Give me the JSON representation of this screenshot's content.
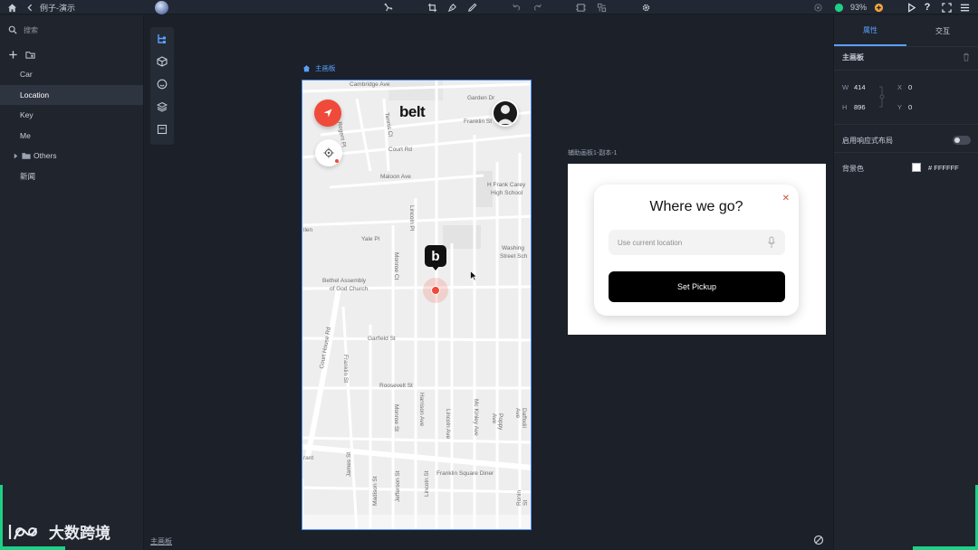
{
  "topbar": {
    "back_label": "例子-演示",
    "zoom": "93%"
  },
  "left_panel": {
    "search_placeholder": "搜索",
    "pages": [
      {
        "label": "Car"
      },
      {
        "label": "Location"
      },
      {
        "label": "Key"
      },
      {
        "label": "Me"
      },
      {
        "label": "Others"
      },
      {
        "label": "新闻"
      }
    ],
    "brand": "大数跨境"
  },
  "canvas": {
    "main_board_label": "主画板",
    "aux_board_label": "辅助画板1-副本-1",
    "bottom_board_label": "主画板"
  },
  "map": {
    "logo": "belt",
    "marker_letter": "b",
    "streets": {
      "cambridge": "Cambridge Ave",
      "garden": "Garden Dr",
      "franklin_top": "Franklin St",
      "regent": "Regent Pl",
      "tennis": "Tennis Ct",
      "court_rd": "Court Rd",
      "maloon": "Maloon Ave",
      "school": "H Frank Carey",
      "school2": "High School",
      "lincoln_pl": "Lincoln Pl",
      "yale": "Yale Pl",
      "allen": "llen",
      "washington": "Washing",
      "washington2": "Street Sch",
      "monroe_top": "Monroe Ct",
      "bethel": "Bethel Assembly",
      "bethel2": "of God Church",
      "court_house": "Court House Rd",
      "garfield": "Garfield St",
      "franklin_mid": "Franklin St",
      "roosevelt": "Roosevelt St",
      "monroe": "Monroe St",
      "harrison": "Harrison Ave",
      "lincoln_ave": "Lincoln Ave",
      "mckinley": "Mc Kinley Ave",
      "poppy": "Poppy Ave",
      "daffodil": "Daffodil Ave",
      "grant": "rant",
      "james": "James St",
      "madison": "Madison St",
      "jefferson": "Jefferson St",
      "lincoln_st": "Lincoln St",
      "franklin_sq": "Franklin Square Diner",
      "ronin": "Ronin St"
    }
  },
  "card": {
    "title": "Where we go?",
    "location_placeholder": "Use current location",
    "button_label": "Set Pickup"
  },
  "right_panel": {
    "tab_properties": "属性",
    "tab_interaction": "交互",
    "section_title": "主画板",
    "w_label": "W",
    "w_value": "414",
    "h_label": "H",
    "h_value": "896",
    "x_label": "X",
    "x_value": "0",
    "y_label": "Y",
    "y_value": "0",
    "responsive_label": "启用响应式布局",
    "bg_label": "背景色",
    "bg_value": "# FFFFFF"
  },
  "colors": {
    "accent": "#5aa0ff",
    "pin_red": "#f04a3a",
    "status_green": "#1fcf86",
    "status_orange": "#f2a33a"
  }
}
